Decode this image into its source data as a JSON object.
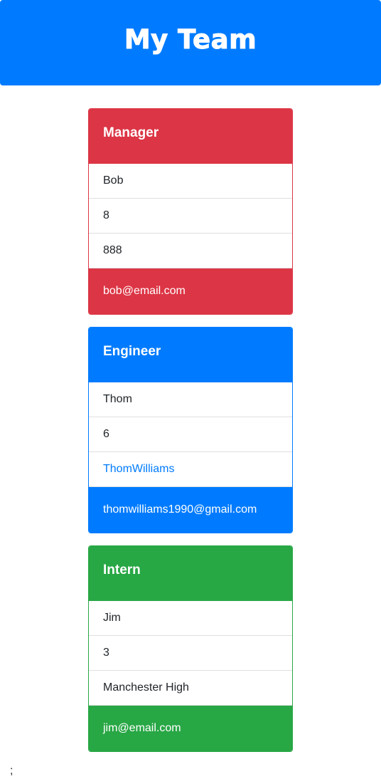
{
  "header": {
    "title": "My Team"
  },
  "colors": {
    "header_bg": "#007bff",
    "manager": "#dc3545",
    "engineer": "#007bff",
    "intern": "#28a745",
    "link": "#007bff"
  },
  "cards": [
    {
      "role": "Manager",
      "name": "Bob",
      "id": "8",
      "detail": "888",
      "email": "bob@email.com"
    },
    {
      "role": "Engineer",
      "name": "Thom",
      "id": "6",
      "detail": "ThomWilliams",
      "email": "thomwilliams1990@gmail.com"
    },
    {
      "role": "Intern",
      "name": "Jim",
      "id": "3",
      "detail": "Manchester High",
      "email": "jim@email.com"
    }
  ],
  "footer_text": ";"
}
